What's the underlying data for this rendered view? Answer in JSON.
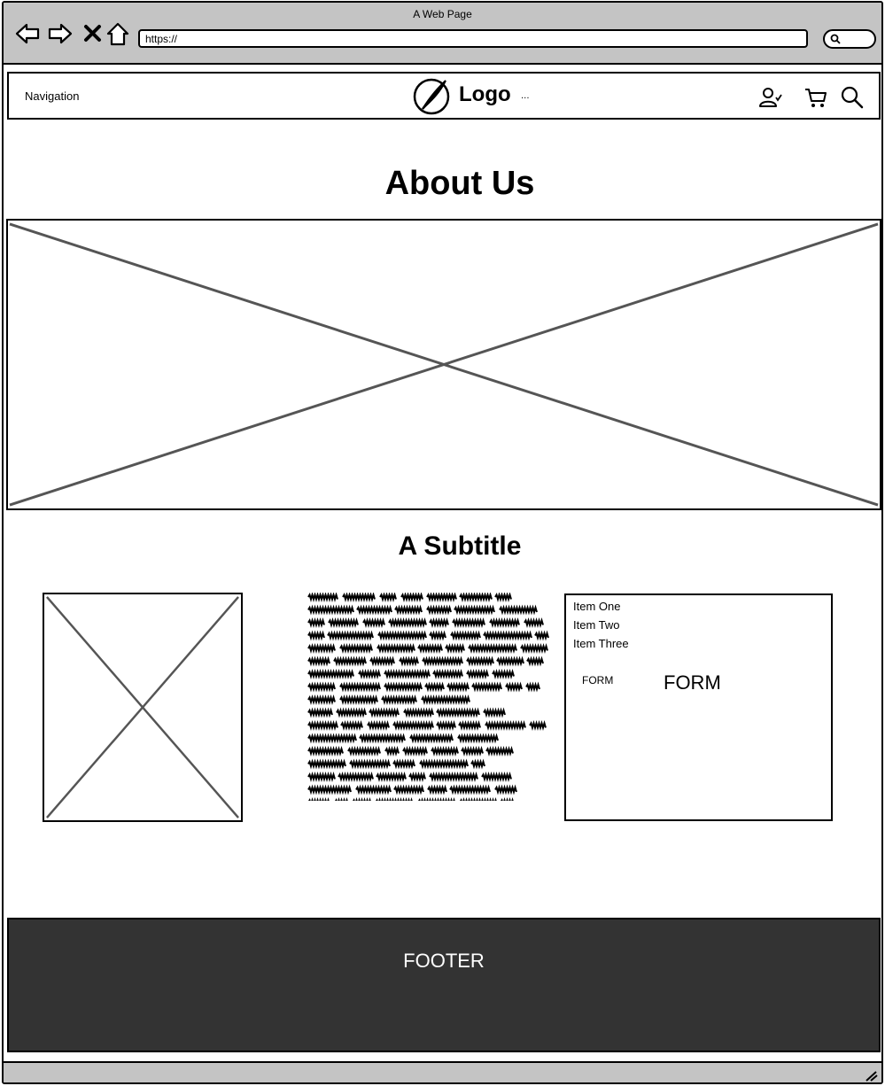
{
  "browser": {
    "window_title": "A Web Page",
    "url": "https://",
    "nav_icons": [
      "back-arrow-icon",
      "forward-arrow-icon",
      "close-x-icon",
      "home-icon"
    ],
    "search_icon": "search-icon"
  },
  "header": {
    "navigation_label": "Navigation",
    "logo_text": "Logo",
    "logo_ellipsis": "...",
    "icons": [
      "user-check-icon",
      "cart-icon",
      "search-icon"
    ]
  },
  "main": {
    "title": "About Us",
    "subtitle": "A Subtitle",
    "list_items": [
      "Item One",
      "Item Two",
      "Item Three"
    ],
    "form_label_small": "FORM",
    "form_label_large": "FORM"
  },
  "footer": {
    "label": "FOOTER",
    "background": "#333333"
  },
  "colors": {
    "chrome": "#c4c4c4",
    "placeholder_lines": "#555555"
  }
}
